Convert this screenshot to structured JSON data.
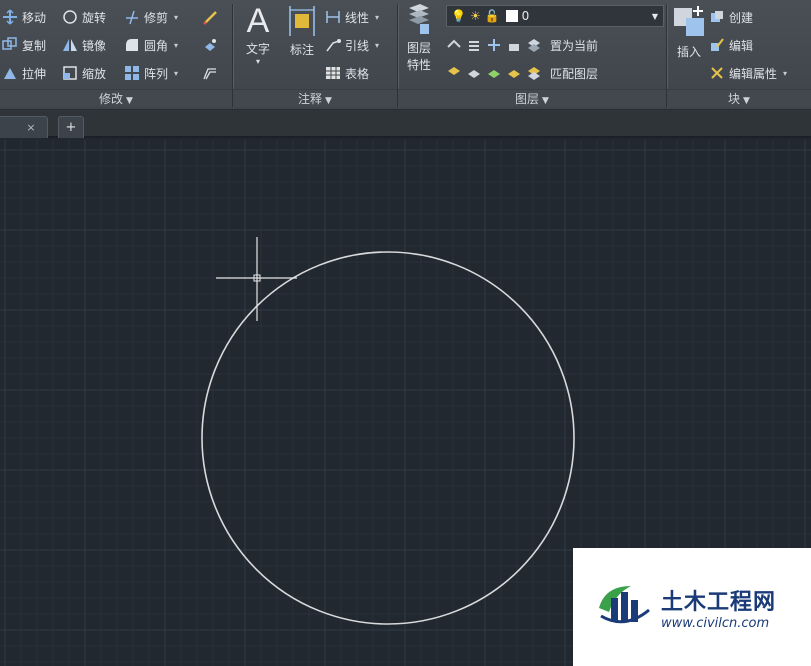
{
  "ribbon": {
    "modify": {
      "title": "修改",
      "tools": {
        "move": "移动",
        "rotate": "旋转",
        "trim": "修剪",
        "copy": "复制",
        "mirror": "镜像",
        "fillet": "圆角",
        "stretch": "拉伸",
        "scale": "缩放",
        "array": "阵列"
      }
    },
    "annotation": {
      "title": "注释",
      "text": "文字",
      "dimension": "标注",
      "linear": "线性",
      "leader": "引线",
      "table": "表格"
    },
    "layers": {
      "title": "图层",
      "layer_properties_line1": "图层",
      "layer_properties_line2": "特性",
      "current_layer": "0",
      "set_current": "置为当前",
      "match_layer": "匹配图层"
    },
    "block": {
      "title": "块",
      "insert": "插入",
      "create": "创建",
      "edit": "编辑",
      "edit_attributes": "编辑属性"
    }
  },
  "tabs": {
    "close_glyph": "×",
    "new_tab_glyph": "+"
  },
  "colors": {
    "canvas_bg": "#212830",
    "grid_minor": "#29313b",
    "grid_major": "#313a46",
    "circle": "#d8dadc",
    "crosshair": "#e6e6e6",
    "watermark_blue": "#1a3a78",
    "watermark_green": "#3aa14a"
  },
  "watermark": {
    "title": "土木工程网",
    "url": "www.civilcn.com"
  }
}
